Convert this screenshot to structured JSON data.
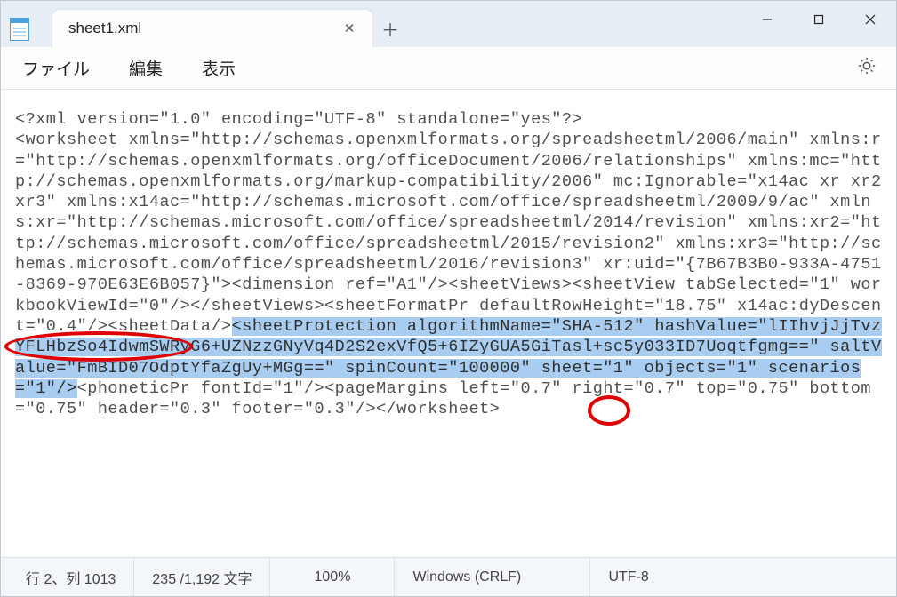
{
  "titlebar": {
    "tab_title": "sheet1.xml",
    "tab_close": "✕",
    "new_tab": "＋"
  },
  "menubar": {
    "file": "ファイル",
    "edit": "編集",
    "view": "表示"
  },
  "content": {
    "line1": "<?xml version=\"1.0\" encoding=\"UTF-8\" standalone=\"yes\"?>",
    "line2": "<worksheet xmlns=\"http://schemas.openxmlformats.org/spreadsheetml/2006/main\" xmlns:r=\"http://schemas.openxmlformats.org/officeDocument/2006/relationships\" xmlns:mc=\"http://schemas.openxmlformats.org/markup-compatibility/2006\" mc:Ignorable=\"x14ac xr xr2 xr3\" xmlns:x14ac=\"http://schemas.microsoft.com/office/spreadsheetml/2009/9/ac\" xmlns:xr=\"http://schemas.microsoft.com/office/spreadsheetml/2014/revision\" xmlns:xr2=\"http://schemas.microsoft.com/office/spreadsheetml/2015/revision2\" xmlns:xr3=\"http://schemas.microsoft.com/office/spreadsheetml/2016/revision3\" xr:uid=\"{7B67B3B0-933A-4751-8369-970E63E6B057}\"><dimension ref=\"A1\"/><sheetViews><sheetView tabSelected=\"1\" workbookViewId=\"0\"/></sheetViews><sheetFormatPr defaultRowHeight=\"18.75\" x14ac:dyDescent=\"0.4\"/><sheetData/>",
    "selected": "<sheetProtection algorithmName=\"SHA-512\" hashValue=\"lIIhvjJjTvzYFLHbzSo4IdwmSWRyG6+UZNzzGNyVq4D2S2exVfQ5+6IZyGUA5GiTasl+sc5y033ID7Uoqtfgmg==\" saltValue=\"FmBID07OdptYfaZgUy+MGg==\" spinCount=\"100000\" sheet=\"1\" objects=\"1\" scenarios=\"1\"/>",
    "after": "<phoneticPr fontId=\"1\"/><pageMargins left=\"0.7\" right=\"0.7\" top=\"0.75\" bottom=\"0.75\" header=\"0.3\" footer=\"0.3\"/></worksheet>"
  },
  "statusbar": {
    "position": "行 2、列 1013",
    "chars": "235 /1,192 文字",
    "zoom": "100%",
    "line_ending": "Windows (CRLF)",
    "encoding": "UTF-8"
  },
  "window_controls": {
    "minimize": "—",
    "maximize": "☐",
    "close": "✕"
  }
}
